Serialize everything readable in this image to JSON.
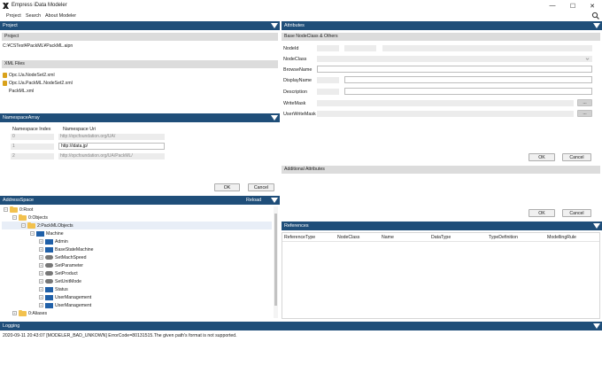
{
  "window": {
    "title": "Empress iData Modeler",
    "minimize": "—",
    "maximize": "☐",
    "close": "✕"
  },
  "menu": {
    "items": [
      "Project",
      "Search",
      "About Modeler"
    ]
  },
  "project_panel": {
    "header": "Project",
    "sub_header": "Project",
    "path": "C:¥CSTest¥PackML¥PackML.aipn",
    "xml_files_header": "XML Files",
    "xml_files": [
      "Opc.Ua.NodeSet2.xml",
      "Opc.Ua.PackML.NodeSet2.xml",
      "PackML.xml"
    ]
  },
  "namespace_panel": {
    "header": "NamespaceArray",
    "col_index": "Namespace Index",
    "col_uri": "Namespace Uri",
    "rows": [
      {
        "index": "0",
        "uri": "http://opcfoundation.org/UA/"
      },
      {
        "index": "1",
        "uri": "http://idata.jp/"
      },
      {
        "index": "2",
        "uri": "http://opcfoundation.org/UA/PackML/"
      }
    ],
    "ok": "OK",
    "cancel": "Cancel"
  },
  "address_space": {
    "header": "AddressSpace",
    "reload": "Reload",
    "tree": [
      {
        "label": "0:Root",
        "indent": 0,
        "icon": "folder",
        "toggle": "−"
      },
      {
        "label": "0:Objects",
        "indent": 1,
        "icon": "folder",
        "toggle": "−"
      },
      {
        "label": "2:PackMLObjects",
        "indent": 2,
        "icon": "folder",
        "toggle": "−"
      },
      {
        "label": "Machine",
        "indent": 3,
        "icon": "blue",
        "toggle": "−"
      },
      {
        "label": "Admin",
        "indent": 4,
        "icon": "blue",
        "toggle": "+"
      },
      {
        "label": "BaseStateMachine",
        "indent": 4,
        "icon": "blue",
        "toggle": "+"
      },
      {
        "label": "SetMachSpeed",
        "indent": 4,
        "icon": "method",
        "toggle": "+"
      },
      {
        "label": "SetParameter",
        "indent": 4,
        "icon": "method",
        "toggle": "+"
      },
      {
        "label": "SetProduct",
        "indent": 4,
        "icon": "method",
        "toggle": "+"
      },
      {
        "label": "SetUnitMode",
        "indent": 4,
        "icon": "method",
        "toggle": "+"
      },
      {
        "label": "Status",
        "indent": 4,
        "icon": "blue",
        "toggle": "+"
      },
      {
        "label": "UserManagement",
        "indent": 4,
        "icon": "blue",
        "toggle": "+"
      },
      {
        "label": "UserManagement",
        "indent": 4,
        "icon": "blue",
        "toggle": "+"
      },
      {
        "label": "0:Aliases",
        "indent": 1,
        "icon": "folder",
        "toggle": "+"
      },
      {
        "label": "0:Server",
        "indent": 1,
        "icon": "blue",
        "toggle": "+"
      }
    ]
  },
  "attributes": {
    "header": "Attributes",
    "base_header": "Base NodeClass & Others",
    "fields": [
      "NodeId",
      "NodeClass",
      "BrowseName",
      "DisplayName",
      "Description",
      "WriteMask",
      "UserWriteMask"
    ],
    "ellipsis": "...",
    "ok": "OK",
    "cancel": "Cancel",
    "additional_header": "Additional Attributes",
    "ok2": "OK",
    "cancel2": "Cancel"
  },
  "references": {
    "header": "References",
    "columns": [
      "ReferenceType",
      "NodeClass",
      "Name",
      "DataType",
      "TypeDefinition",
      "ModellingRule"
    ]
  },
  "logging": {
    "header": "Logging",
    "line": "2020-09-11 20:43:07 [MODELER_BAD_UNKOWN] ErrorCode=80131515.The given path's format is not supported."
  },
  "colors": {
    "header": "#1f4e79",
    "folder": "#f2c14e",
    "node": "#2060a8"
  }
}
